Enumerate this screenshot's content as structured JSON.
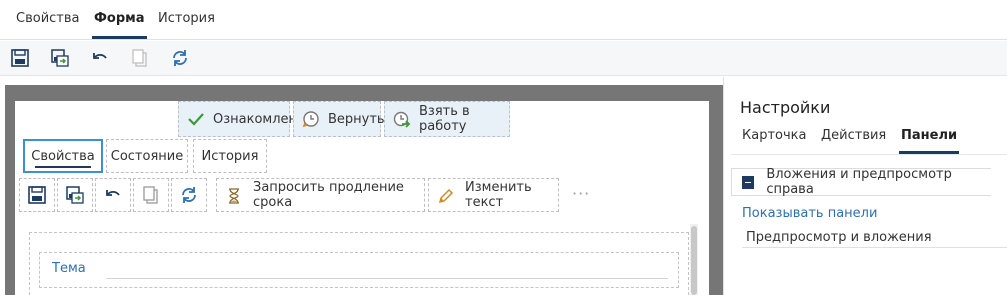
{
  "top_tabs": [
    {
      "label": "Свойства"
    },
    {
      "label": "Форма"
    },
    {
      "label": "История"
    }
  ],
  "toolbar_icons": [
    "save-icon",
    "save-and-continue-icon",
    "undo-icon",
    "copy-icon",
    "refresh-icon"
  ],
  "action_buttons": [
    {
      "label": "Ознакомлен",
      "icon": "checkmark-icon"
    },
    {
      "label": "Вернуть",
      "icon": "clock-return-icon"
    },
    {
      "label": "Взять в работу",
      "icon": "clock-arrow-icon"
    }
  ],
  "inner_tabs": [
    {
      "label": "Свойства"
    },
    {
      "label": "Состояние"
    },
    {
      "label": "История"
    }
  ],
  "inner_toolbar": {
    "request_extension_label": "Запросить продление срока",
    "edit_text_label": "Изменить текст",
    "more_label": "···"
  },
  "form": {
    "subject_label": "Тема"
  },
  "settings_panel": {
    "title": "Настройки",
    "tabs": [
      {
        "label": "Карточка"
      },
      {
        "label": "Действия"
      },
      {
        "label": "Панели"
      }
    ],
    "group_label": "Вложения и предпросмотр справа",
    "show_panels_label": "Показывать панели",
    "show_panels_value": "Предпросмотр и вложения"
  },
  "colors": {
    "accent": "#1e3a5f",
    "link": "#2e6fb0",
    "action_bg": "#e9f1f8",
    "canvas_frame": "#767676",
    "active_tab_border": "#3a8fd6"
  }
}
